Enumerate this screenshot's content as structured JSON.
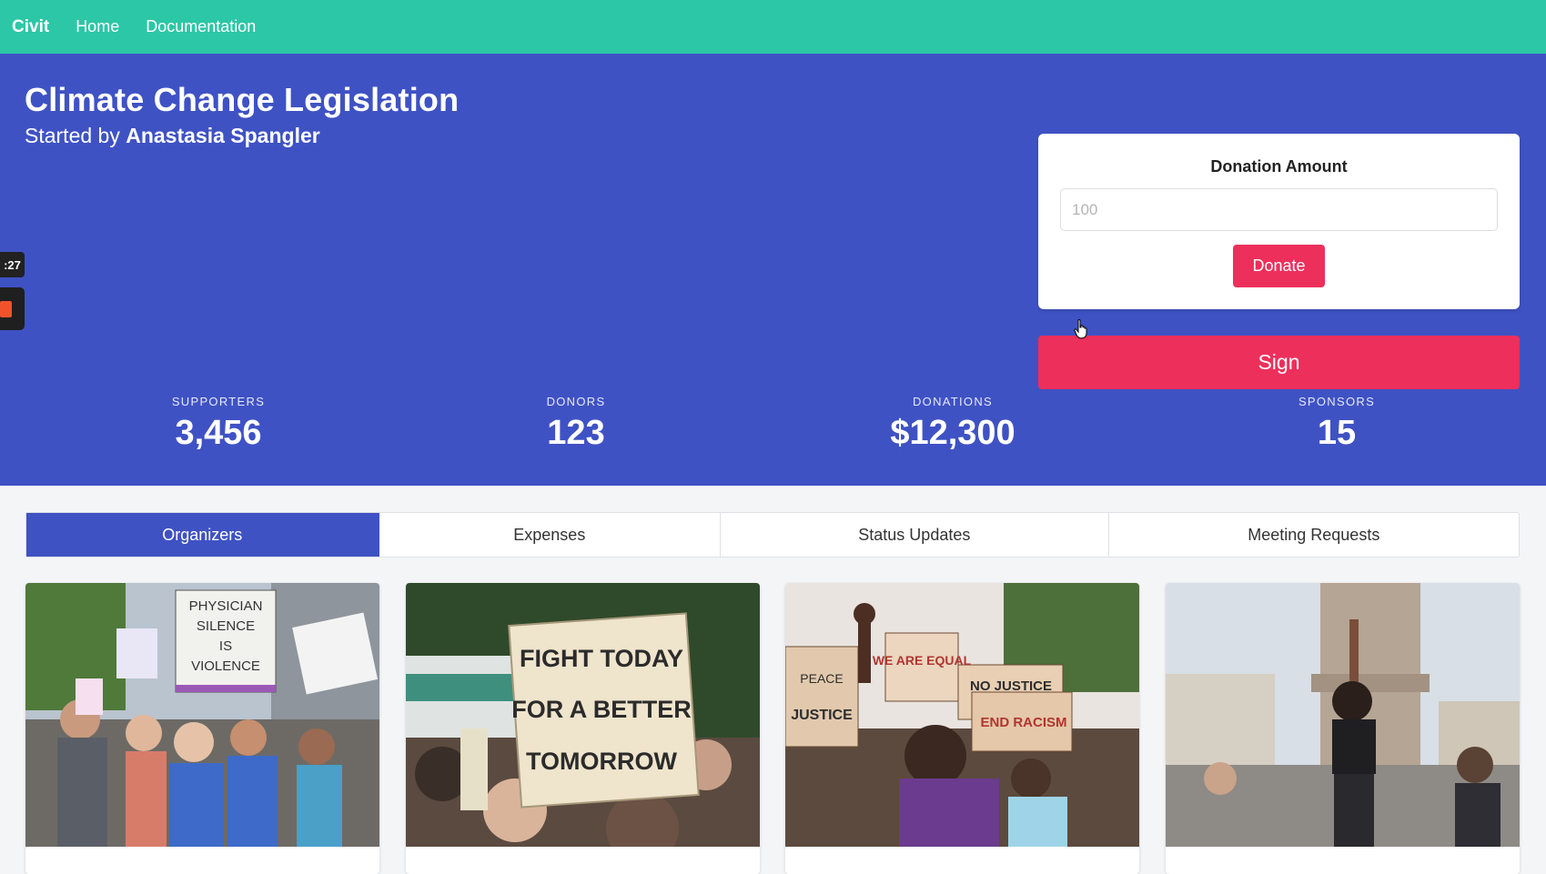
{
  "navbar": {
    "brand": "Civit",
    "links": [
      "Home",
      "Documentation"
    ]
  },
  "hero": {
    "title": "Climate Change Legislation",
    "subtitle_prefix": "Started by ",
    "author": "Anastasia Spangler"
  },
  "recorder": {
    "time": ":27"
  },
  "donation": {
    "label": "Donation Amount",
    "placeholder": "100",
    "donate_label": "Donate"
  },
  "sign_label": "Sign",
  "stats": [
    {
      "label": "SUPPORTERS",
      "value": "3,456"
    },
    {
      "label": "DONORS",
      "value": "123"
    },
    {
      "label": "DONATIONS",
      "value": "$12,300"
    },
    {
      "label": "SPONSORS",
      "value": "15"
    }
  ],
  "tabs": [
    "Organizers",
    "Expenses",
    "Status Updates",
    "Meeting Requests"
  ],
  "active_tab": "Organizers",
  "cards": [
    {
      "sign_lines": [
        "PHYSICIAN",
        "SILENCE",
        "IS",
        "VIOLENCE"
      ]
    },
    {
      "sign_lines": [
        "FIGHT TODAY",
        "FOR A BETTER",
        "TOMORROW"
      ]
    },
    {
      "sign_lines": [
        "WE ARE EQUAL",
        "NO JUSTICE",
        "END RACISM",
        "PEACE",
        "JUSTICE"
      ]
    },
    {
      "sign_lines": []
    }
  ],
  "colors": {
    "navbar": "#2cc7a6",
    "hero": "#3f52c4",
    "accent": "#ec2f5b"
  }
}
